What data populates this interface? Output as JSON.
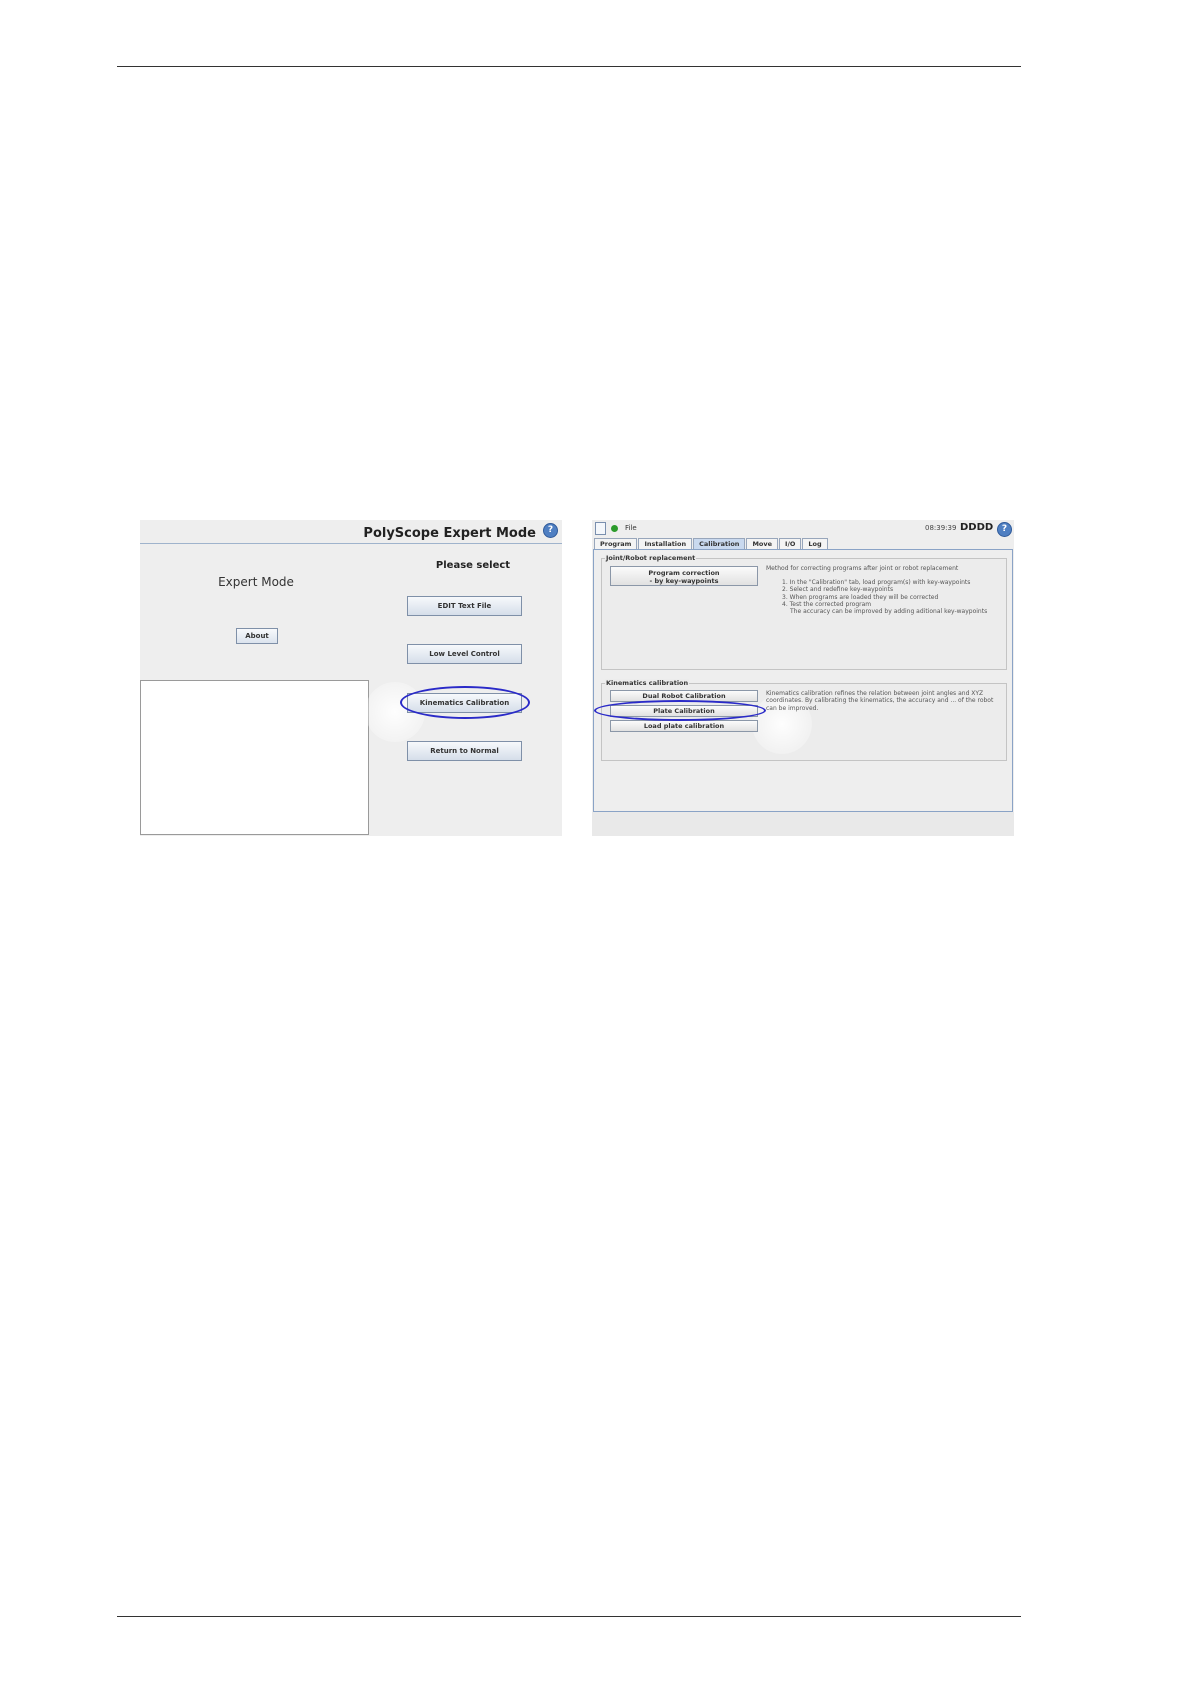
{
  "expert_mode_panel": {
    "title": "PolyScope Expert Mode",
    "heading": "Expert Mode",
    "about_label": "About",
    "select_label": "Please select",
    "buttons": [
      "EDIT Text File",
      "Low Level Control",
      "Kinematics Calibration",
      "Return to Normal"
    ]
  },
  "calibration_panel": {
    "menu_file": "File",
    "time": "08:39:39",
    "robot_name": "DDDD",
    "tabs": [
      "Program",
      "Installation",
      "Calibration",
      "Move",
      "I/O",
      "Log"
    ],
    "active_tab": "Calibration",
    "joint_group": {
      "title": "Joint/Robot replacement",
      "button_line1": "Program correction",
      "button_line2": "- by key-waypoints",
      "description": "Method for correcting programs after joint or robot replacement",
      "steps": [
        "1. In the \"Calibration\" tab, load program(s) with key-waypoints",
        "2. Select and redefine key-waypoints",
        "3. When programs are loaded they will be corrected",
        "4. Test the corrected program"
      ],
      "note": "The accuracy can be improved by adding aditional key-waypoints"
    },
    "kinematics_group": {
      "title": "Kinematics calibration",
      "buttons": [
        "Dual Robot Calibration",
        "Plate Calibration",
        "Load plate calibration"
      ],
      "description": "Kinematics calibration refines the relation between joint angles and XYZ coordinates. By calibrating the kinematics, the accuracy and ... of the robot can be improved."
    }
  },
  "colors": {
    "highlight_ellipse": "#2a2ac8",
    "active_tab": "#c9d9ef",
    "status_ok": "#2c9b2c"
  },
  "icons": [
    "help-icon",
    "status-ok-icon",
    "ur-logo-icon"
  ]
}
